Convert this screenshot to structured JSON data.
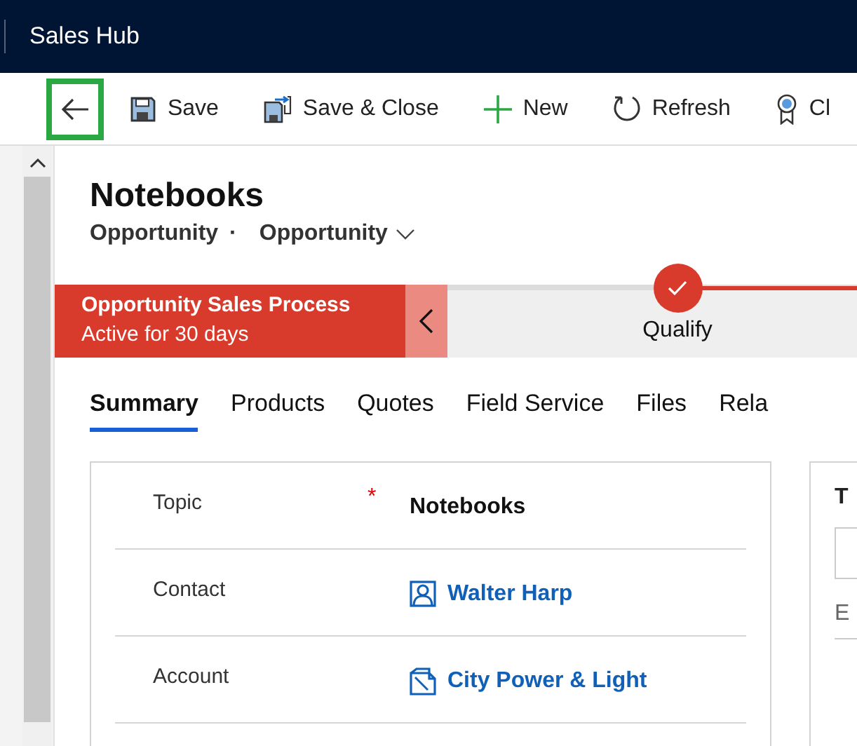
{
  "app_title": "Sales Hub",
  "toolbar": [
    {
      "kind": "back",
      "focused": true
    },
    {
      "kind": "save",
      "label": "Save",
      "focused": false
    },
    {
      "kind": "save_close",
      "label": "Save & Close",
      "focused": false
    },
    {
      "kind": "new",
      "label": "New",
      "focused": false
    },
    {
      "kind": "refresh",
      "label": "Refresh",
      "focused": false
    },
    {
      "kind": "ribbon",
      "label": "Cl",
      "focused": false
    }
  ],
  "record": {
    "title": "Notebooks",
    "entity": "Opportunity",
    "separator": "·",
    "form": "Opportunity"
  },
  "process": {
    "name": "Opportunity Sales Process",
    "duration": "Active for 30 days",
    "stages": [
      {
        "label": "Qualify",
        "completed": true
      }
    ]
  },
  "tabs": [
    {
      "label": "Summary",
      "selected": true
    },
    {
      "label": "Products",
      "selected": false
    },
    {
      "label": "Quotes",
      "selected": false
    },
    {
      "label": "Field Service",
      "selected": false
    },
    {
      "label": "Files",
      "selected": false
    },
    {
      "label": "Rela",
      "selected": false
    }
  ],
  "fields": [
    {
      "label": "Topic",
      "required_mark": "*",
      "value": "Notebooks",
      "kind": "text"
    },
    {
      "label": "Contact",
      "value": "Walter Harp",
      "kind": "contact"
    },
    {
      "label": "Account",
      "value": "City Power & Light",
      "kind": "account"
    }
  ],
  "side_card": {
    "heading": "T",
    "label": "E"
  }
}
